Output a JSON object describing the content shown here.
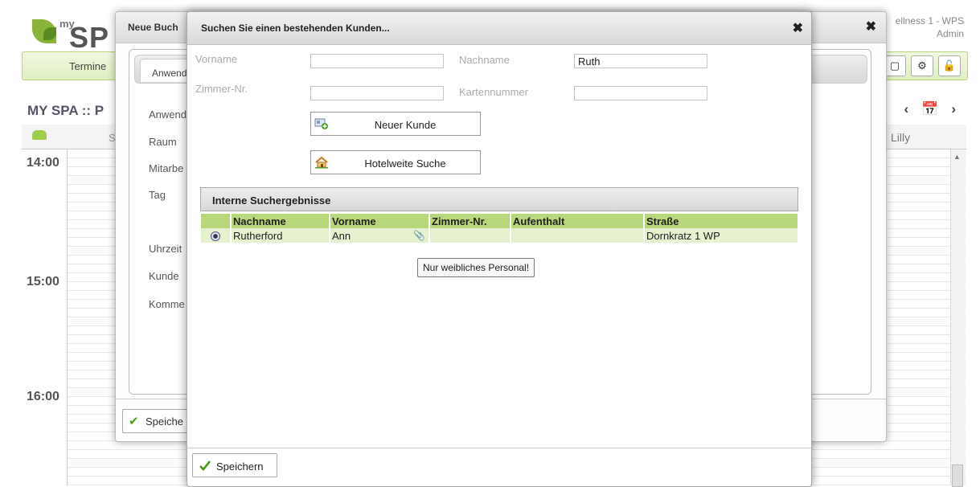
{
  "app": {
    "logo_my": "my",
    "logo_sp": "SP",
    "hotel": "ellness 1 - WPS",
    "user": "Admin",
    "nav_termine": "Termine",
    "spa_title": "MY SPA :: P",
    "staff_col": "S",
    "staff_lilly": "Lilly",
    "times": [
      "14:00",
      "15:00",
      "16:00"
    ],
    "icons": [
      "window-icon",
      "gears-icon",
      "lock-icon"
    ]
  },
  "booking": {
    "title": "Neue Buch",
    "tab": "Anwend",
    "labels": [
      "Anwend",
      "Raum",
      "Mitarbe",
      "Tag",
      "Uhrzeit",
      "Kunde",
      "Komme"
    ],
    "save": "Speiche"
  },
  "search": {
    "title": "Suchen Sie einen bestehenden Kunden...",
    "fields": {
      "vorname_label": "Vorname",
      "vorname_value": "",
      "nachname_label": "Nachname",
      "nachname_value": "Ruth",
      "zimmer_label": "Zimmer-Nr.",
      "zimmer_value": "",
      "karten_label": "Kartennummer",
      "karten_value": ""
    },
    "btn_new_customer": "Neuer Kunde",
    "btn_hotel_search": "Hotelweite Suche",
    "results_title": "Interne Suchergebnisse",
    "columns": [
      "Nachname",
      "Vorname",
      "Zimmer-Nr.",
      "Aufenthalt",
      "Straße"
    ],
    "rows": [
      {
        "nachname": "Rutherford",
        "vorname": "Ann",
        "zimmer": "",
        "aufenthalt": "",
        "strasse": "Dornkratz 1 WP"
      }
    ],
    "tooltip": "Nur weibliches Personal!",
    "save": "Speichern"
  },
  "colors": {
    "accent_green": "#b8d67a",
    "row_green": "#e6f1cf",
    "nav_green": "#dfefbf"
  }
}
